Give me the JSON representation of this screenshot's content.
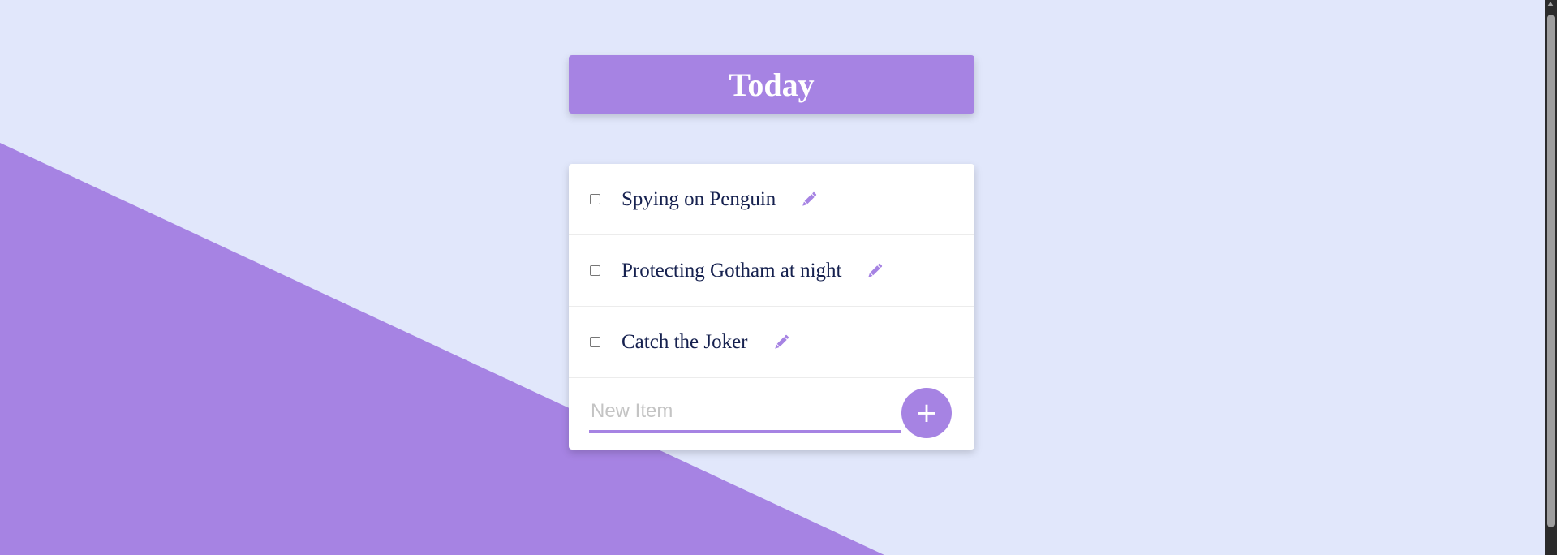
{
  "header": {
    "title": "Today"
  },
  "items": [
    {
      "label": "Spying on Penguin",
      "checked": false
    },
    {
      "label": "Protecting Gotham at night",
      "checked": false
    },
    {
      "label": "Catch the Joker",
      "checked": false
    }
  ],
  "new_item": {
    "placeholder": "New Item",
    "value": "",
    "add_label": "+"
  },
  "icons": {
    "edit": "pencil-icon",
    "add": "plus-icon"
  },
  "colors": {
    "accent": "#a683e3",
    "background": "#e1e7fb",
    "card": "#ffffff",
    "item_text": "#16214f"
  }
}
